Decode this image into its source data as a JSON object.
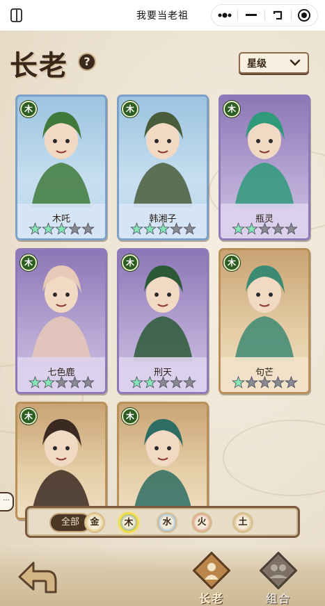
{
  "topbar": {
    "title": "我要当老祖",
    "doc_icon": "document-icon",
    "capsule": [
      "more-icon",
      "minimize-icon",
      "restore-icon",
      "record-icon"
    ]
  },
  "header": {
    "title": "长老",
    "help_label": "?",
    "sort_label": "星级"
  },
  "cards": [
    {
      "name": "木吒",
      "element": "木",
      "stars_filled": 3,
      "stars_total": 5,
      "theme": "blue",
      "accent": "#3f7a3a"
    },
    {
      "name": "韩湘子",
      "element": "木",
      "stars_filled": 3,
      "stars_total": 5,
      "theme": "blue",
      "accent": "#4a5d3b"
    },
    {
      "name": "瓶灵",
      "element": "木",
      "stars_filled": 2,
      "stars_total": 5,
      "theme": "purple",
      "accent": "#2f9a7a"
    },
    {
      "name": "七色鹿",
      "element": "木",
      "stars_filled": 2,
      "stars_total": 5,
      "theme": "purple",
      "accent": "#e7c9b7"
    },
    {
      "name": "刑天",
      "element": "木",
      "stars_filled": 2,
      "stars_total": 5,
      "theme": "purple",
      "accent": "#2c5a37"
    },
    {
      "name": "句芒",
      "element": "木",
      "stars_filled": 1,
      "stars_total": 5,
      "theme": "gold",
      "accent": "#3d8a74"
    },
    {
      "name": "",
      "element": "木",
      "stars_filled": 0,
      "stars_total": 0,
      "theme": "gold",
      "accent": "#3b2a22"
    },
    {
      "name": "",
      "element": "木",
      "stars_filled": 0,
      "stars_total": 0,
      "theme": "gold",
      "accent": "#2e6d63"
    }
  ],
  "filters": {
    "all_label": "全部",
    "elements": [
      {
        "label": "金",
        "color": "#d9a441",
        "selected": false
      },
      {
        "label": "木",
        "color": "#3d7a2a",
        "selected": true
      },
      {
        "label": "水",
        "color": "#3f8fc4",
        "selected": false
      },
      {
        "label": "火",
        "color": "#c2463a",
        "selected": false
      },
      {
        "label": "土",
        "color": "#b8893f",
        "selected": false
      }
    ]
  },
  "side_bubble": "···",
  "bottom_nav": {
    "back_icon": "back-arrow-icon",
    "tabs": [
      {
        "label": "长老",
        "active": true
      },
      {
        "label": "组合",
        "active": false
      }
    ]
  },
  "colors": {
    "star_filled": "#86e5b6",
    "star_empty": "#8a8a92",
    "badge": "#2d5d23",
    "frame_brown": "#7a5b40"
  }
}
